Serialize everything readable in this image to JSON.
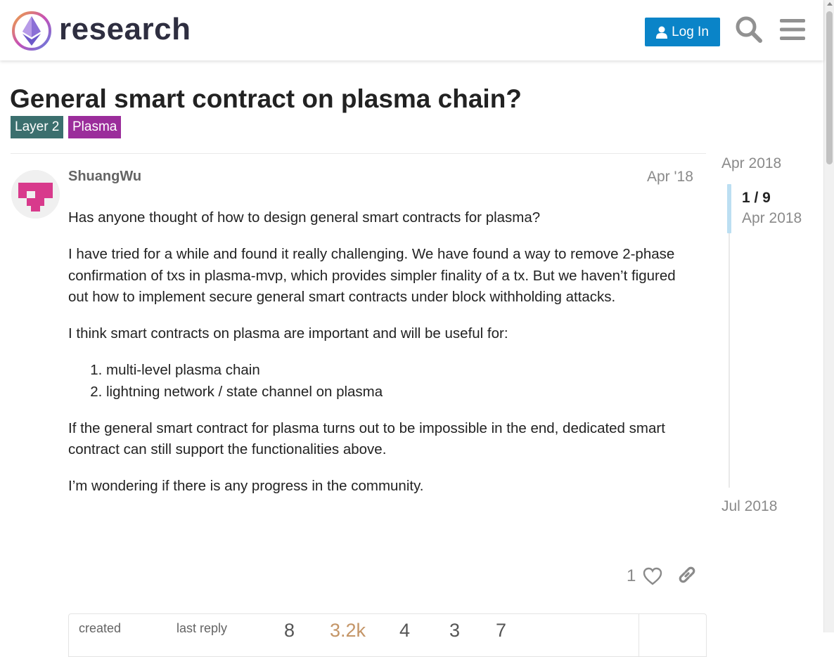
{
  "header": {
    "logo_text": "research",
    "login_label": "Log In",
    "search_icon": "search-icon",
    "menu_icon": "hamburger-menu-icon",
    "accent": "#0a84c8"
  },
  "topic": {
    "title": "General smart contract on plasma chain?",
    "tags": [
      {
        "label": "Layer 2",
        "color": "#3b6f6e"
      },
      {
        "label": "Plasma",
        "color": "#9b2d9b"
      }
    ]
  },
  "post": {
    "username": "ShuangWu",
    "date": "Apr '18",
    "paragraphs": [
      "Has anyone thought of how to design general smart contracts for plasma?",
      "I have tried for a while and found it really challenging. We have found a way to remove 2-phase confirmation of txs in plasma-mvp, which provides simpler finality of a tx. But we haven’t figured out how to implement secure general smart contracts under block withholding attacks.",
      "I think smart contracts on plasma are important and will be useful for:",
      "If the general smart contract for plasma turns out to be impossible in the end, dedicated smart contract can still support the functionalities above.",
      "I’m wondering if there is any progress in the community."
    ],
    "list": [
      "multi-level plasma chain",
      "lightning network / state channel on plasma"
    ],
    "like_count": "1"
  },
  "stats": {
    "created_label": "created",
    "last_reply_label": "last reply",
    "replies": "8",
    "views": "3.2k",
    "users": "4",
    "likes": "3",
    "links": "7"
  },
  "timeline": {
    "top_date": "Apr 2018",
    "position": "1 / 9",
    "position_date": "Apr 2018",
    "bottom_date": "Jul 2018"
  }
}
